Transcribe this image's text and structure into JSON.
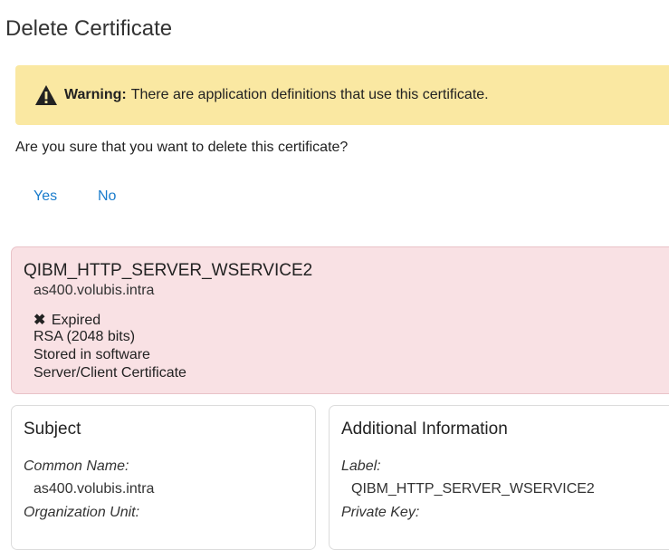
{
  "page": {
    "title": "Delete Certificate"
  },
  "warning": {
    "icon": "warning-triangle-icon",
    "bold_label": "Warning:",
    "message": "There are application definitions that use this certificate."
  },
  "confirm": {
    "question": "Are you sure that you want to delete this certificate?",
    "yes_label": "Yes",
    "no_label": "No"
  },
  "certificate": {
    "name": "QIBM_HTTP_SERVER_WSERVICE2",
    "host": "as400.volubis.intra",
    "status_icon": "x-mark-icon",
    "status": "Expired",
    "algorithm": "RSA (2048 bits)",
    "storage": "Stored in software",
    "type": "Server/Client Certificate"
  },
  "subject": {
    "title": "Subject",
    "fields": [
      {
        "label": "Common Name:",
        "value": "as400.volubis.intra"
      },
      {
        "label": "Organization Unit:",
        "value": ""
      }
    ]
  },
  "additional": {
    "title": "Additional Information",
    "fields": [
      {
        "label": "Label:",
        "value": "QIBM_HTTP_SERVER_WSERVICE2"
      },
      {
        "label": "Private Key:",
        "value": ""
      }
    ]
  },
  "colors": {
    "warning_bg": "#fae8a2",
    "cert_bg": "#f9e1e4",
    "link": "#1a7ccc"
  }
}
